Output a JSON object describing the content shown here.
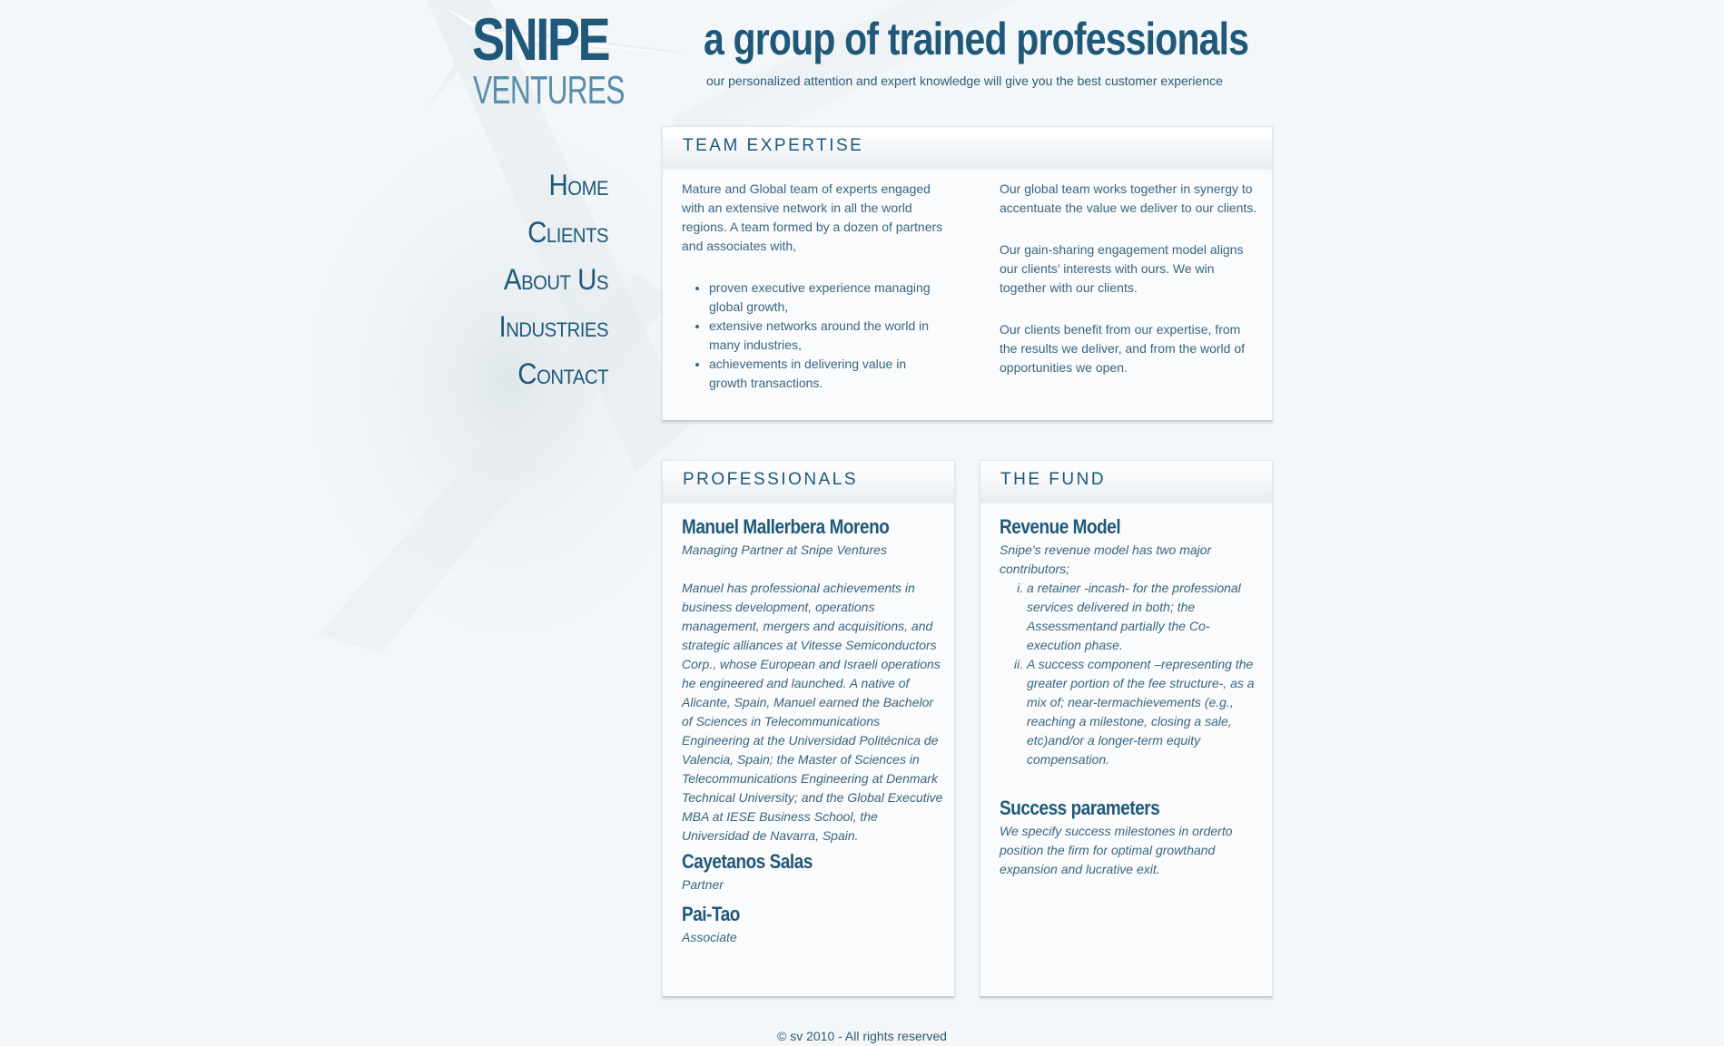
{
  "logo": {
    "line1": "SNIPE",
    "line2": "VENTURES"
  },
  "header": {
    "tagline": "a group of trained professionals",
    "subtagline": "our personalized attention and expert knowledge will give you the best customer experience"
  },
  "nav": [
    {
      "label": "Home"
    },
    {
      "label": "Clients"
    },
    {
      "label": "About Us"
    },
    {
      "label": "Industries"
    },
    {
      "label": "Contact"
    }
  ],
  "team_expertise": {
    "title": "TEAM EXPERTISE",
    "intro": "Mature and Global team of experts engaged with an extensive network in all the world regions. A team formed by a dozen of partners and associates with,",
    "bullets": [
      "proven executive experience managing global growth,",
      "extensive networks around the world in many industries,",
      "achievements in delivering value in growth transactions."
    ],
    "paragraphs": [
      "Our global team works together in synergy to accentuate the value we deliver to our clients.",
      "Our gain-sharing engagement model aligns our clients’ interests with ours. We win together with our clients.",
      "Our clients benefit from our expertise, from the results we deliver, and from the world of opportunities we open."
    ]
  },
  "professionals": {
    "title": "PROFESSIONALS",
    "people": [
      {
        "name": "Manuel Mallerbera Moreno",
        "role": "Managing Partner at Snipe Ventures",
        "bio": "Manuel has professional achievements in business development, operations management, mergers and acquisitions, and strategic alliances at Vitesse Semiconductors Corp., whose European and Israeli operations he engineered and launched. A native of Alicante, Spain, Manuel earned the Bachelor of Sciences in Telecommunications Engineering at the Universidad Politécnica de Valencia, Spain; the Master of Sciences in Telecommunications Engineering at Denmark Technical University; and the Global Executive MBA at IESE Business School, the Universidad de Navarra, Spain."
      },
      {
        "name": "Cayetanos Salas",
        "role": "Partner"
      },
      {
        "name": "Pai-Tao",
        "role": "Associate"
      }
    ]
  },
  "fund": {
    "title": "THE FUND",
    "revenue_heading": "Revenue Model",
    "revenue_intro": "Snipe’s revenue model has two major contributors;",
    "revenue_items": [
      "a retainer -incash- for the professional services delivered in both; the Assessmentand partially the Co-execution phase.",
      "A success component –representing the greater portion of the fee structure-, as a mix of; near-termachievements (e.g., reaching a milestone, closing a sale, etc)and/or a longer-term equity compensation."
    ],
    "success_heading": "Success parameters",
    "success_text": "We specify success milestones in orderto position the firm for optimal growthand expansion and lucrative exit."
  },
  "footer": {
    "text": "© sv 2010 - All rights reserved"
  }
}
